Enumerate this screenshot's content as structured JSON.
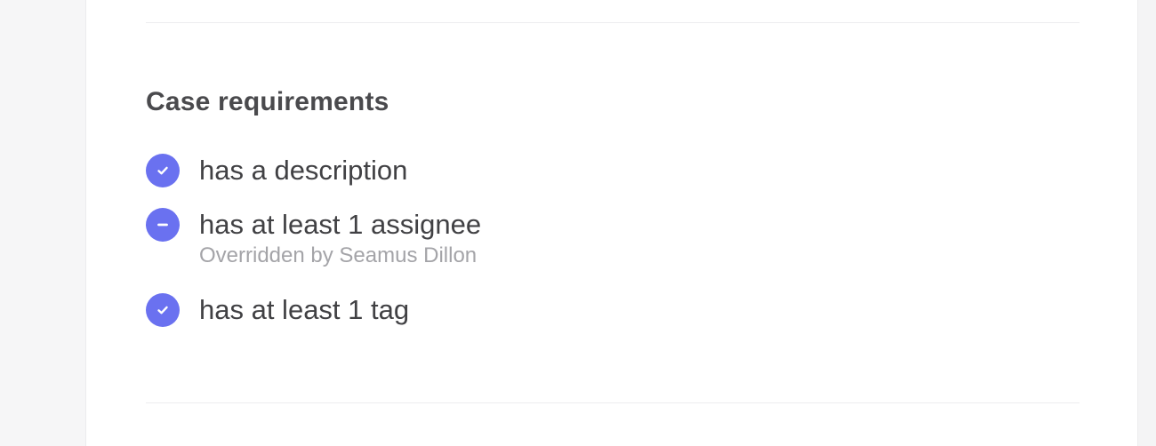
{
  "section": {
    "title": "Case requirements"
  },
  "requirements": [
    {
      "label": "has a description",
      "status": "met",
      "icon": "check-circle-icon",
      "note": ""
    },
    {
      "label": "has at least 1 assignee",
      "status": "overridden",
      "icon": "minus-circle-icon",
      "note": "Overridden by Seamus Dillon"
    },
    {
      "label": "has at least 1 tag",
      "status": "met",
      "icon": "check-circle-icon",
      "note": ""
    }
  ],
  "colors": {
    "accent": "#6a71f0",
    "text": "#414144",
    "muted": "#a4a4a8"
  }
}
